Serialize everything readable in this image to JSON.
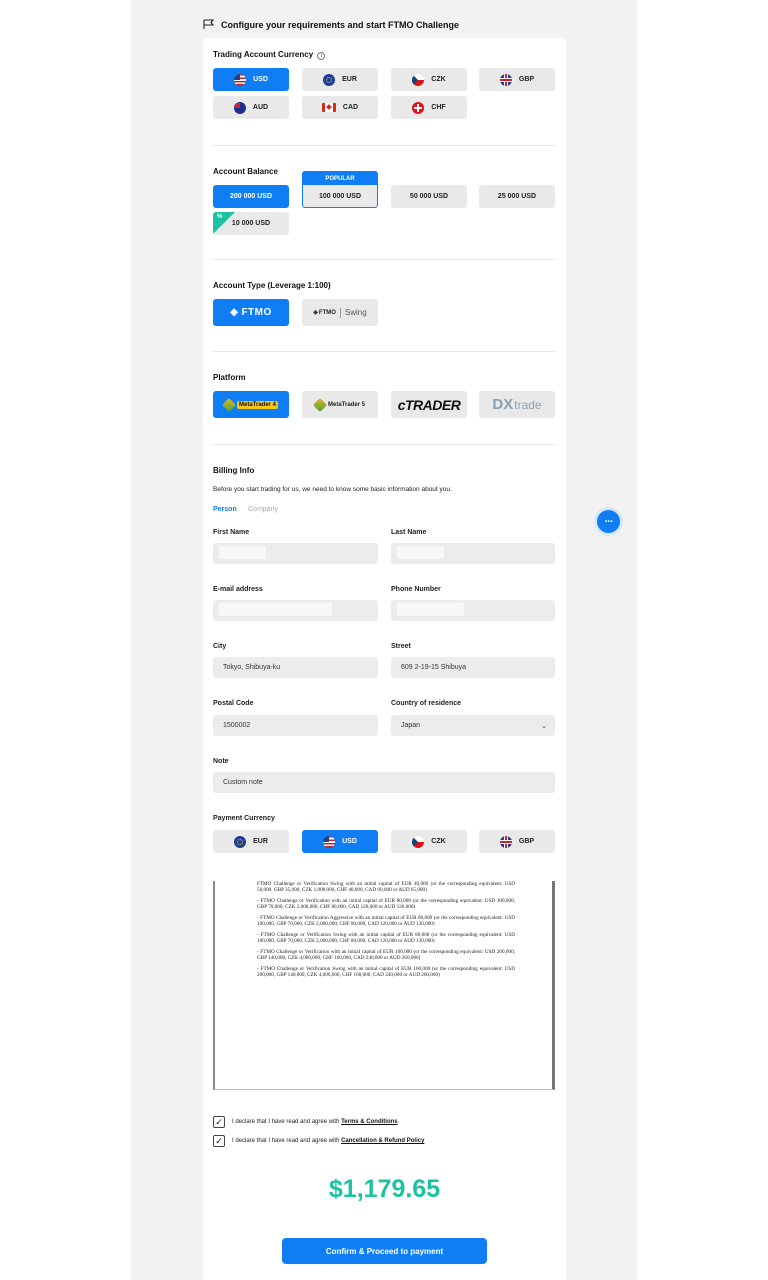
{
  "header": {
    "title": "Configure your requirements and start FTMO Challenge"
  },
  "currency_section": {
    "title": "Trading Account Currency",
    "options": [
      "USD",
      "EUR",
      "CZK",
      "GBP",
      "AUD",
      "CAD",
      "CHF"
    ],
    "selected": "USD"
  },
  "balance_section": {
    "title": "Account Balance",
    "options": [
      "200 000 USD",
      "100 000 USD",
      "50 000 USD",
      "25 000 USD",
      "10 000 USD"
    ],
    "popular_badge": "POPULAR",
    "discount_badge": "%",
    "selected": "200 000 USD"
  },
  "type_section": {
    "title": "Account Type (Leverage 1:100)",
    "ftmo_label": "FTMO",
    "swing_label": "FTMO",
    "swing_suffix": "Swing"
  },
  "platform_section": {
    "title": "Platform",
    "mt4_label": "MetaTrader 4",
    "mt5_label": "MetaTrader 5",
    "ctrader_label": "cTRADER",
    "dx_label": "DX",
    "dx_suffix": "trade"
  },
  "billing": {
    "title": "Billing Info",
    "subtitle": "Before you start trading for us, we need to know some basic information about you.",
    "tab_person": "Person",
    "tab_company": "Company",
    "first_name_label": "First Name",
    "last_name_label": "Last Name",
    "email_label": "E-mail address",
    "phone_label": "Phone Number",
    "city_label": "City",
    "city_value": "Tokyo, Shibuya-ku",
    "street_label": "Street",
    "street_value": "609 2-19-15 Shibuya",
    "postal_label": "Postal Code",
    "postal_value": "1500002",
    "country_label": "Country of residence",
    "country_value": "Japan",
    "note_label": "Note",
    "note_value": "Custom note"
  },
  "payment": {
    "title": "Payment Currency",
    "options": [
      "EUR",
      "USD",
      "CZK",
      "GBP"
    ],
    "selected": "USD"
  },
  "terms_doc": {
    "paragraphs": [
      "FTMO Challenge or Verification Swing with an initial capital of EUR 40,000 (or the corresponding equivalent: USD 50,000, GBP 35,000, CZK 1,000,000, CHF 40,000, CAD 60,000 or AUD 65,000)",
      "- FTMO Challenge or Verification with an initial capital of EUR 80,000 (or the corresponding equivalent: USD 100,000, GBP 70,000, CZK 2,000,000, CHF 80,000, CAD 120,000 or AUD 130,000)",
      "- FTMO Challenge or Verification Aggressive with an initial capital of EUR 80,000 (or the corresponding equivalent: USD 100,000, GBP 70,000, CZK 2,000,000, CHF 80,000, CAD 120,000 or AUD 130,000)",
      "- FTMO Challenge or Verification Swing with an initial capital of EUR 80,000 (or the corresponding equivalent: USD 100,000, GBP 70,000, CZK 2,000,000, CHF 80,000, CAD 120,000 or AUD 130,000)",
      "- FTMO Challenge or Verification with an initial capital of EUR 160,000 (or the corresponding equivalent: USD 200,000, GBP 140,000, CZK 4,000,000, CHF 160,000, CAD 240,000 or AUD 260,000)",
      "- FTMO Challenge or Verification Swing with an initial capital of EUR 160,000 (or the corresponding equivalent: USD 200,000, GBP 140,000, CZK 4,000,000, CHF 160,000, CAD 240,000 or AUD 260,000)"
    ]
  },
  "agreements": {
    "prefix": "I declare that I have read and agree with",
    "terms_link": "Terms & Conditions",
    "refund_link": "Cancellation & Refund Policy"
  },
  "summary": {
    "price": "$1,179.65",
    "confirm_label": "Confirm & Proceed to payment"
  },
  "colors": {
    "accent": "#0f7ef5",
    "price": "#1cc3a3",
    "panel": "#f2f2f2"
  },
  "icons": [
    "flag-icon",
    "info-icon",
    "chevron-down-icon",
    "check-icon",
    "chat-icon"
  ]
}
